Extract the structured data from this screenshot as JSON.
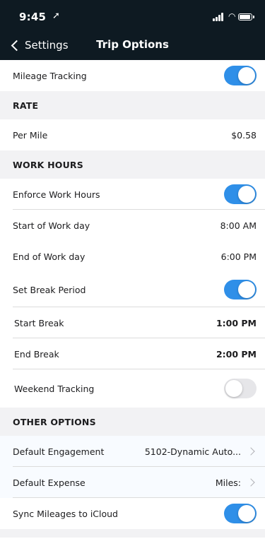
{
  "status_bar": {
    "time": "9:45",
    "location_glyph": "➚"
  },
  "nav": {
    "back_label": "Settings",
    "title": "Trip Options"
  },
  "colors": {
    "accent": "#2f8fe8",
    "header": "#0e1a22"
  },
  "rows": {
    "mileage_tracking": {
      "label": "Mileage Tracking",
      "on": true
    },
    "rate_header": "RATE",
    "per_mile": {
      "label": "Per Mile",
      "value": "$0.58"
    },
    "work_hours_header": "WORK HOURS",
    "enforce_work_hours": {
      "label": "Enforce Work Hours",
      "on": true
    },
    "start_work_day": {
      "label": "Start of Work day",
      "value": "8:00 AM"
    },
    "end_work_day": {
      "label": "End of Work day",
      "value": "6:00 PM"
    },
    "set_break_period": {
      "label": "Set Break Period",
      "on": true
    },
    "start_break": {
      "label": "Start Break",
      "value": "1:00 PM"
    },
    "end_break": {
      "label": "End Break",
      "value": "2:00 PM"
    },
    "weekend_tracking": {
      "label": "Weekend Tracking",
      "on": false
    },
    "other_options_header": "OTHER OPTIONS",
    "default_engagement": {
      "label": "Default Engagement",
      "value": "5102-Dynamic Auto..."
    },
    "default_expense": {
      "label": "Default Expense",
      "value": "Miles:"
    },
    "sync_mileages": {
      "label": "Sync Mileages to iCloud",
      "on": true
    }
  }
}
